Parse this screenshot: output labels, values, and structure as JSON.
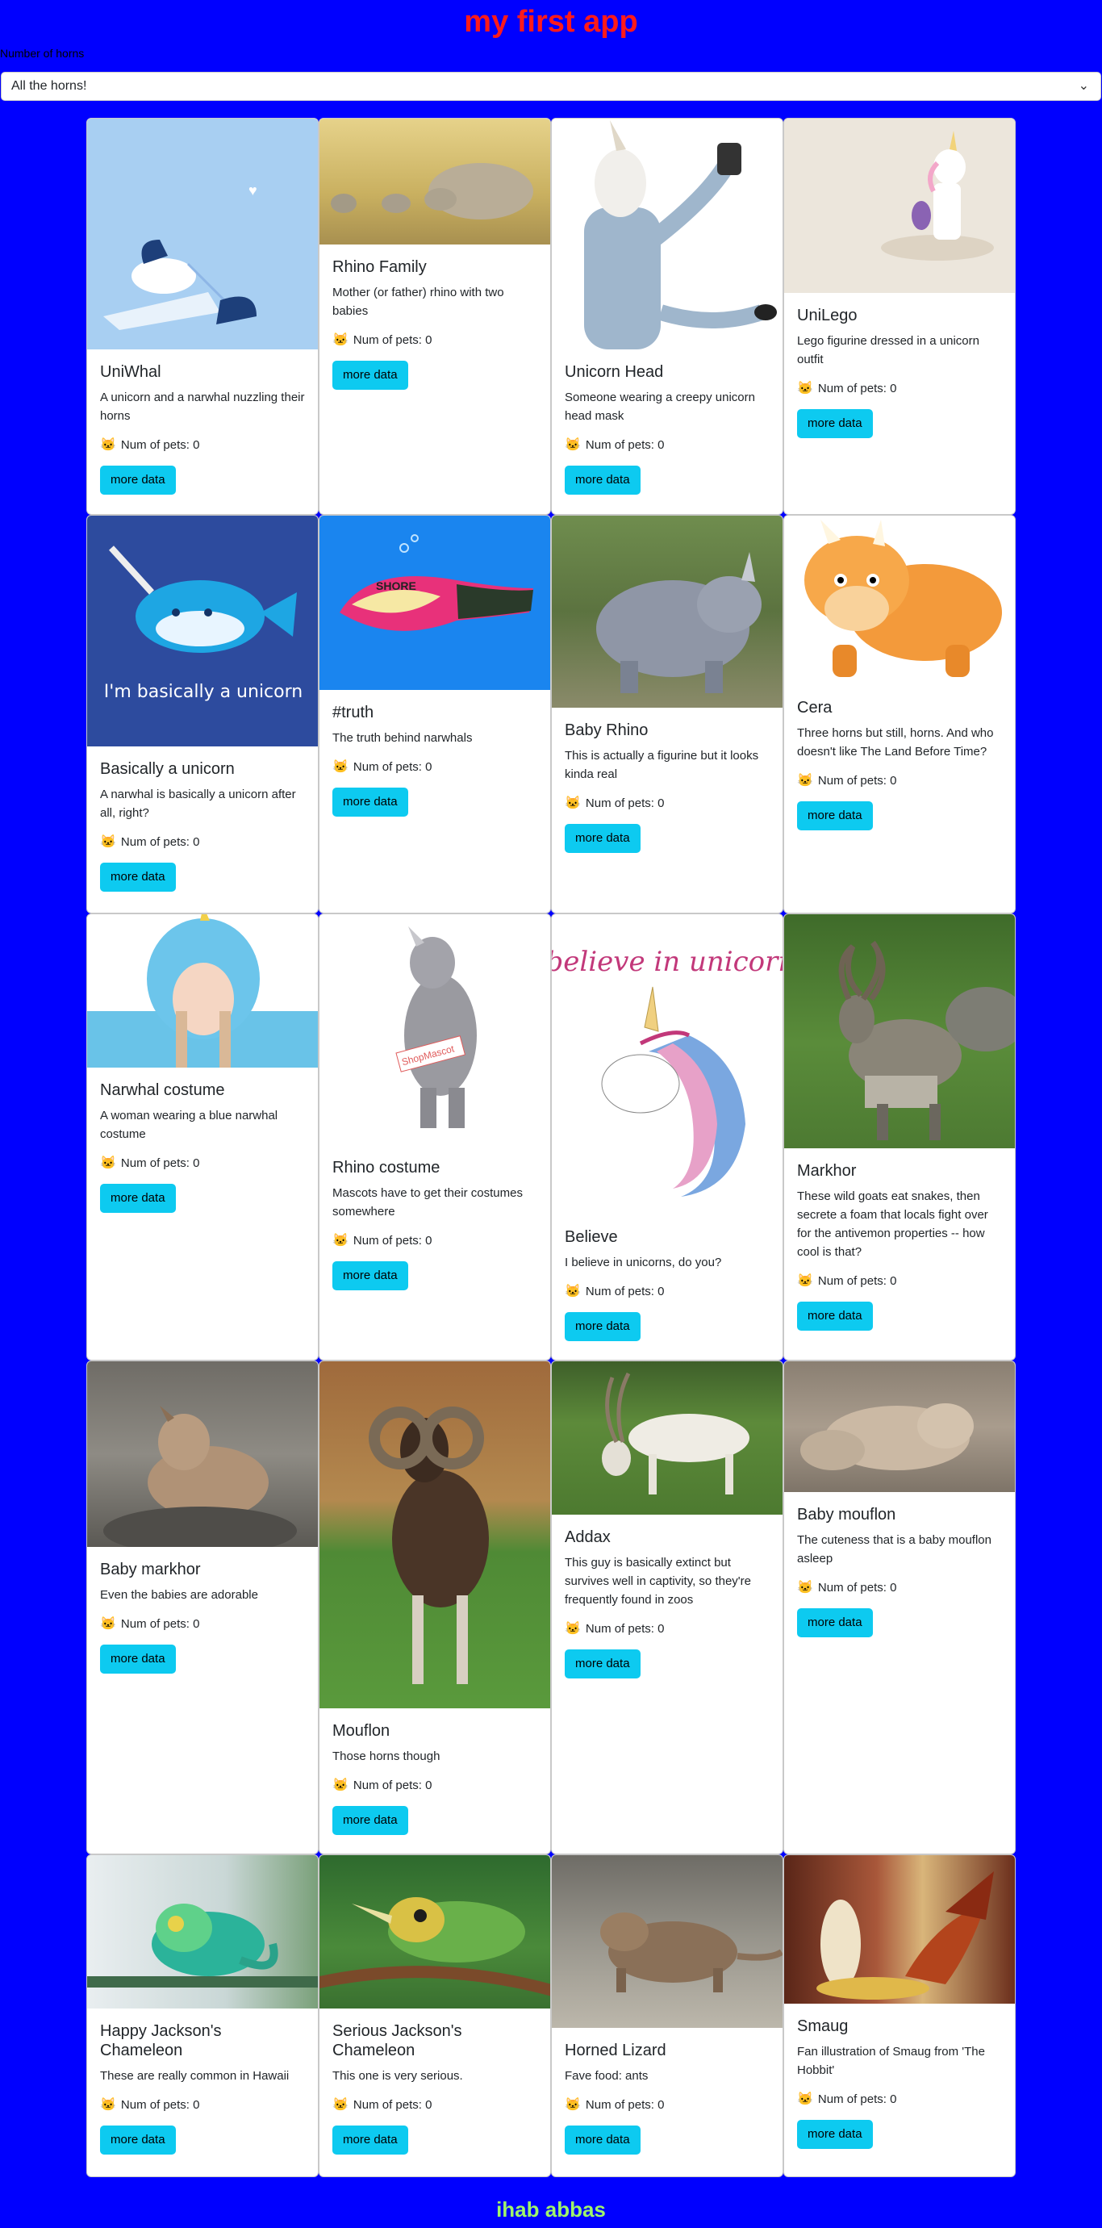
{
  "header": {
    "title": "my first app"
  },
  "filter": {
    "label": "Number of horns",
    "selected": "All the horns!"
  },
  "footer": {
    "author": "ihab abbas"
  },
  "card_common": {
    "pets_label": "Num of pets: 0",
    "button_label": "more data",
    "pets_icon": "cat-face-icon"
  },
  "cards": [
    {
      "title": "UniWhal",
      "description": "A unicorn and a narwhal nuzzling their horns"
    },
    {
      "title": "Rhino Family",
      "description": "Mother (or father) rhino with two babies"
    },
    {
      "title": "Unicorn Head",
      "description": "Someone wearing a creepy unicorn head mask"
    },
    {
      "title": "UniLego",
      "description": "Lego figurine dressed in a unicorn outfit"
    },
    {
      "title": "Basically a unicorn",
      "description": "A narwhal is basically a unicorn after all, right?",
      "image_text": "I'm basically a unicorn"
    },
    {
      "title": "#truth",
      "description": "The truth behind narwhals",
      "image_text": "SHORE"
    },
    {
      "title": "Baby Rhino",
      "description": "This is actually a figurine but it looks kinda real"
    },
    {
      "title": "Cera",
      "description": "Three horns but still, horns. And who doesn't like The Land Before Time?"
    },
    {
      "title": "Narwhal costume",
      "description": "A woman wearing a blue narwhal costume"
    },
    {
      "title": "Rhino costume",
      "description": "Mascots have to get their costumes somewhere",
      "image_text": "ShopMascot"
    },
    {
      "title": "Believe",
      "description": "I believe in unicorns, do you?",
      "image_text": "I believe in unicorns"
    },
    {
      "title": "Markhor",
      "description": "These wild goats eat snakes, then secrete a foam that locals fight over for the antivemon properties -- how cool is that?"
    },
    {
      "title": "Baby markhor",
      "description": "Even the babies are adorable"
    },
    {
      "title": "Mouflon",
      "description": "Those horns though"
    },
    {
      "title": "Addax",
      "description": "This guy is basically extinct but survives well in captivity, so they're frequently found in zoos"
    },
    {
      "title": "Baby mouflon",
      "description": "The cuteness that is a baby mouflon asleep"
    },
    {
      "title": "Happy Jackson's Chameleon",
      "description": "These are really common in Hawaii"
    },
    {
      "title": "Serious Jackson's Chameleon",
      "description": "This one is very serious."
    },
    {
      "title": "Horned Lizard",
      "description": "Fave food: ants"
    },
    {
      "title": "Smaug",
      "description": "Fan illustration of Smaug from 'The Hobbit'"
    }
  ]
}
